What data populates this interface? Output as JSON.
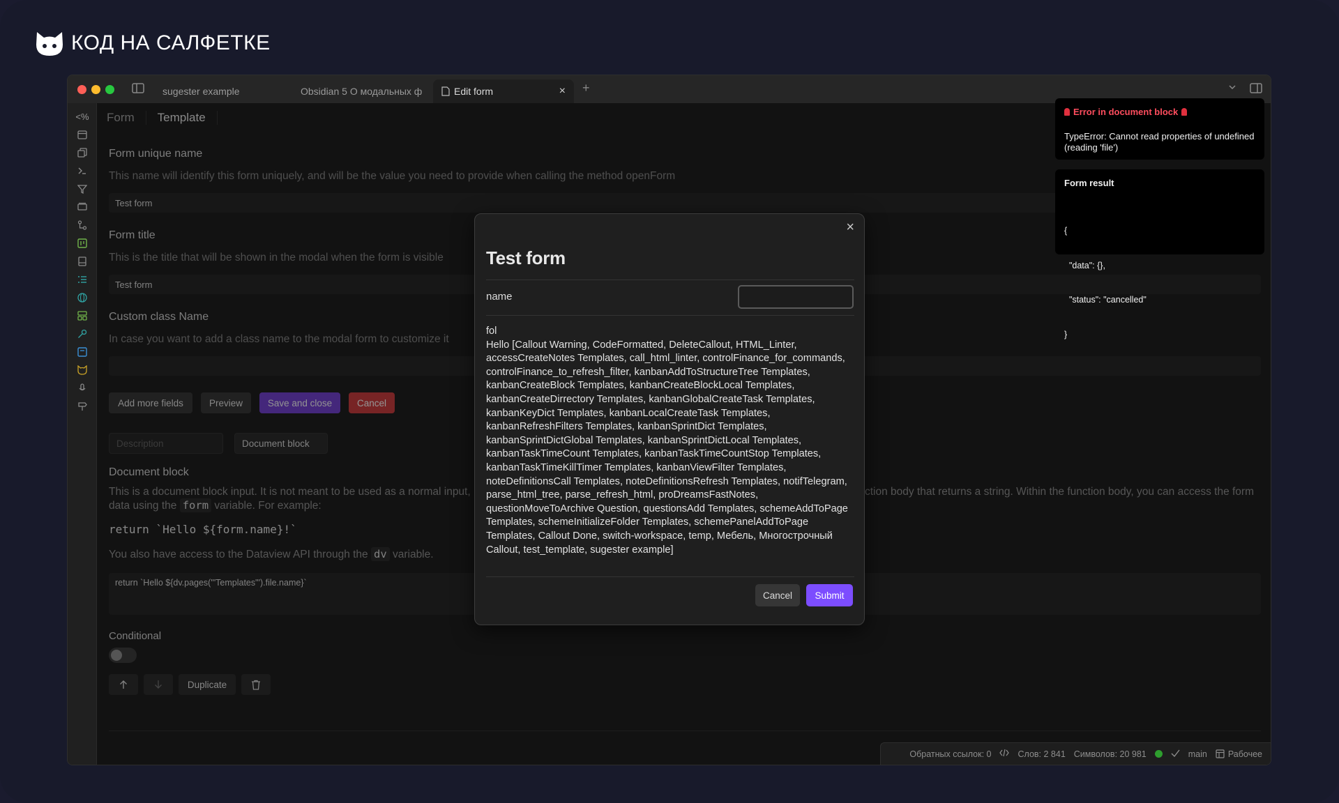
{
  "brand": {
    "text": "КОД НА САЛФЕТКЕ",
    "logo_icon": "cat-icon"
  },
  "window": {
    "tabs": [
      {
        "label": "sugester example"
      },
      {
        "label": "Obsidian 5 О модальных фо..."
      },
      {
        "label": "Edit form",
        "close": "×"
      }
    ],
    "new_tab": "+"
  },
  "ribbon": {
    "first": "<%"
  },
  "form_editor": {
    "tabs": [
      "Form",
      "Template"
    ],
    "fields": {
      "unique_name_label": "Form unique name",
      "unique_name_desc": "This name will identify this form uniquely, and will be the value you need to provide when calling the method openForm",
      "unique_name_value": "Test form",
      "title_label": "Form title",
      "title_desc": "This is the title that will be shown in the modal when the form is visible",
      "title_value": "Test form",
      "class_label": "Custom class Name",
      "class_desc": "In case you want to add a class name to the modal form to customize it",
      "class_value": ""
    },
    "buttons": {
      "add_more": "Add more fields",
      "preview": "Preview",
      "save_close": "Save and close",
      "cancel": "Cancel"
    },
    "field_row": {
      "description_placeholder": "Description",
      "type_value": "Document block"
    },
    "document_block": {
      "label": "Document block",
      "desc_part1": "This is a document block input. It is not meant to be used as a normal input,",
      "desc_part2": "ction body that returns a string. Within the function body, you can access the form",
      "desc_line2_a": "data using the",
      "desc_line2_code": "form",
      "desc_line2_b": "variable. For example:",
      "example_code": "return `Hello ${form.name}!`",
      "dv_desc_a": "You also have access to the Dataview API through the",
      "dv_desc_code": "dv",
      "dv_desc_b": "variable.",
      "textarea_value": "return `Hello ${dv.pages('\"Templates\"').file.name}`"
    },
    "conditional_label": "Conditional",
    "row_actions": {
      "duplicate": "Duplicate"
    }
  },
  "statusbar": {
    "backlinks": "Обратных ссылок: 0",
    "words": "Слов: 2 841",
    "chars": "Символов: 20 981",
    "branch": "main",
    "workspace": "Рабочее"
  },
  "notices": {
    "error_title": "Error in document block",
    "error_text": "TypeError: Cannot read properties of undefined (reading 'file')",
    "result_title": "Form result",
    "result_lines": [
      "{",
      "  \"data\": {},",
      "  \"status\": \"cancelled\"",
      "}"
    ]
  },
  "modal": {
    "title": "Test form",
    "close": "×",
    "name_label": "name",
    "result_line1": "fol",
    "result_body": "Hello [Callout Warning, CodeFormatted, DeleteCallout, HTML_Linter, accessCreateNotes Templates, call_html_linter, controlFinance_for_commands, controlFinance_to_refresh_filter, kanbanAddToStructureTree Templates, kanbanCreateBlock Templates, kanbanCreateBlockLocal Templates, kanbanCreateDirrectory Templates, kanbanGlobalCreateTask Templates, kanbanKeyDict Templates, kanbanLocalCreateTask Templates, kanbanRefreshFilters Templates, kanbanSprintDict Templates, kanbanSprintDictGlobal Templates, kanbanSprintDictLocal Templates, kanbanTaskTimeCount Templates, kanbanTaskTimeCountStop Templates, kanbanTaskTimeKillTimer Templates, kanbanViewFilter Templates, noteDefinitionsCall Templates, noteDefinitionsRefresh Templates, notifTelegram, parse_html_tree, parse_refresh_html, proDreamsFastNotes, questionMoveToArchive Question, questionsAdd Templates, schemeAddToPage Templates, schemeInitializeFolder Templates, schemePanelAddToPage Templates, Callout Done, switch-workspace, temp, Мебель, Многострочный Callout, test_template, sugester example]",
    "cancel": "Cancel",
    "submit": "Submit"
  },
  "colors": {
    "accent": "#7c4dff",
    "danger": "#c03a3d",
    "error_title": "#ff4d5e",
    "status_dot": "#2e9e2e"
  }
}
